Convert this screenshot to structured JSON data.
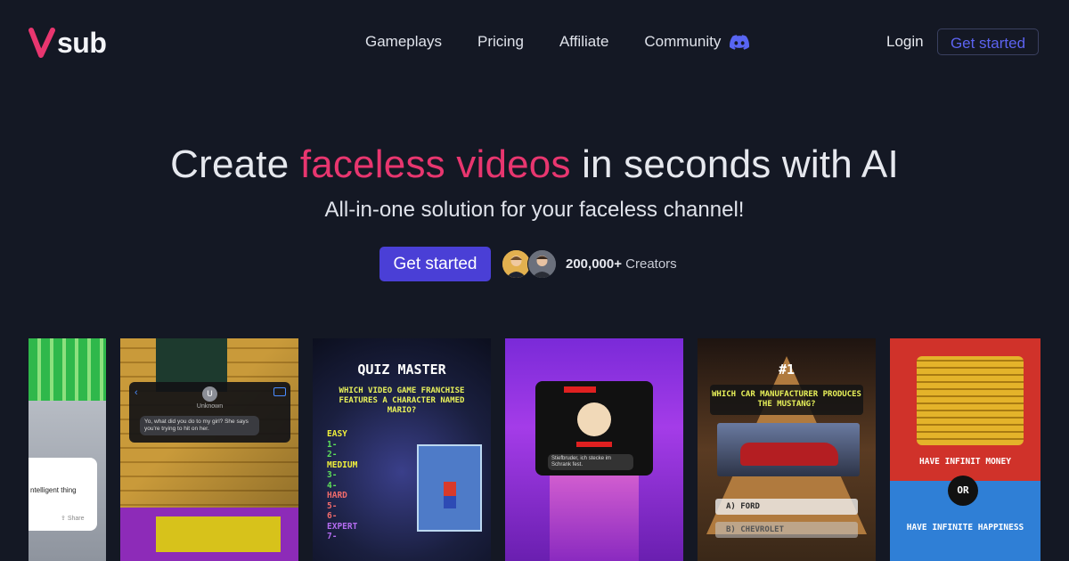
{
  "brand": {
    "name": "sub",
    "logo_letter": "V",
    "accent_color": "#e8366f",
    "primary_color": "#4a3fd6",
    "background_color": "#141824"
  },
  "nav": {
    "links": [
      {
        "label": "Gameplays"
      },
      {
        "label": "Pricing"
      },
      {
        "label": "Affiliate"
      },
      {
        "label": "Community",
        "icon": "discord-icon"
      }
    ],
    "login_label": "Login",
    "cta_label": "Get started"
  },
  "hero": {
    "title_before": "Create ",
    "title_accent": "faceless videos",
    "title_after": " in seconds with AI",
    "subtitle": "All-in-one solution for your faceless channel!",
    "cta_label": "Get started",
    "creators_count": "200,000+",
    "creators_label": "Creators"
  },
  "gallery": {
    "cards": [
      {
        "type": "text-story",
        "popup_text": "ntelligent thing",
        "share_label": "Share"
      },
      {
        "type": "fake-text",
        "contact_initial": "U",
        "contact_name": "Unknown",
        "message": "Yo, what did you do to my girl? She says you're trying to hit on her."
      },
      {
        "type": "quiz",
        "title": "QUIZ MASTER",
        "question": "WHICH VIDEO GAME FRANCHISE FEATURES A CHARACTER NAMED MARIO?",
        "levels": [
          "EASY",
          "1-",
          "2-",
          "MEDIUM",
          "3-",
          "4-",
          "HARD",
          "5-",
          "6-",
          "EXPERT",
          "7-"
        ]
      },
      {
        "type": "fake-text",
        "message": "Stiefbruder, ich stecke im Schrank fest."
      },
      {
        "type": "quiz",
        "number": "#1",
        "question": "WHICH CAR MANUFACTURER PRODUCES THE MUSTANG?",
        "answers": [
          "A) FORD",
          "B) CHEVROLET"
        ]
      },
      {
        "type": "would-you-rather",
        "option_a": "HAVE INFINIT MONEY",
        "separator": "OR",
        "option_b": "HAVE INFINITE HAPPINESS"
      }
    ]
  }
}
